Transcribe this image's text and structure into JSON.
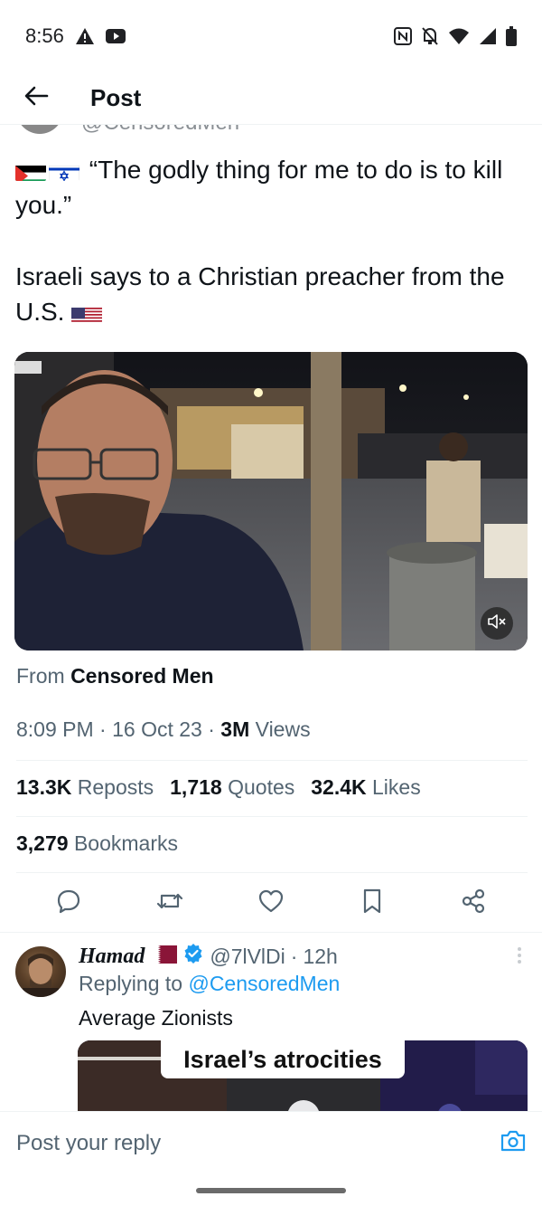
{
  "status_bar": {
    "time": "8:56",
    "left_icons": [
      "warning-icon",
      "youtube-icon"
    ],
    "right_icons": [
      "nfc-icon",
      "bell-off-icon",
      "wifi-icon",
      "signal-icon",
      "battery-icon"
    ]
  },
  "header": {
    "title": "Post"
  },
  "author": {
    "handle": "@CensoredMen"
  },
  "tweet": {
    "line1": "“The godly thing for me to do is to kill you.”",
    "line2": "Israeli says to a Christian preacher from the U.S.",
    "flags": [
      "palestine-flag",
      "israel-flag",
      "usa-flag"
    ]
  },
  "media": {
    "kind": "video",
    "muted": true
  },
  "source": {
    "prefix": "From",
    "name": "Censored Men"
  },
  "meta": {
    "time": "8:09 PM",
    "date": "16 Oct 23",
    "views_count": "3M",
    "views_label": "Views",
    "sep": "·"
  },
  "stats": {
    "reposts_count": "13.3K",
    "reposts_label": "Reposts",
    "quotes_count": "1,718",
    "quotes_label": "Quotes",
    "likes_count": "32.4K",
    "likes_label": "Likes",
    "bookmarks_count": "3,279",
    "bookmarks_label": "Bookmarks"
  },
  "actions": [
    "reply-icon",
    "repost-icon",
    "like-icon",
    "bookmark-icon",
    "share-icon"
  ],
  "reply": {
    "name": "Hamad",
    "handle": "@7lVlDi",
    "time": "12h",
    "sep": "·",
    "replying_prefix": "Replying to",
    "replying_to": "@CensoredMen",
    "text": "Average Zionists",
    "media_caption": "Israel’s atrocities"
  },
  "compose": {
    "placeholder": "Post your reply"
  },
  "colors": {
    "accent": "#1d9bf0",
    "text": "#0f1419",
    "secondary": "#536471"
  }
}
